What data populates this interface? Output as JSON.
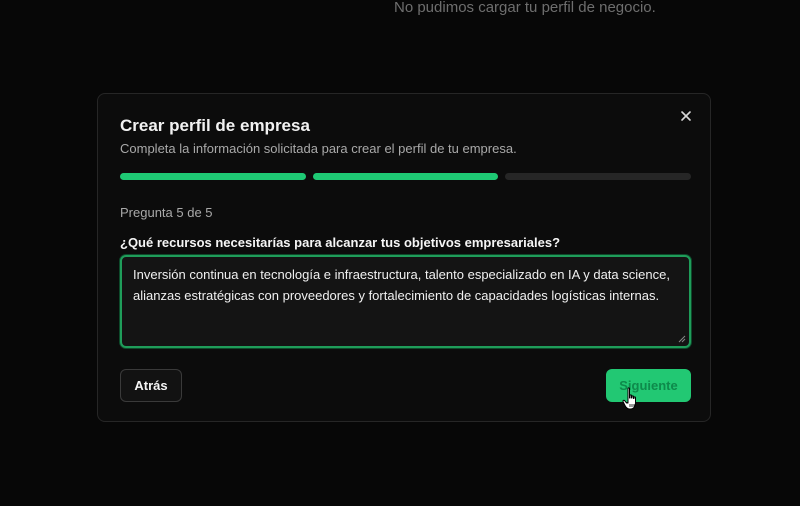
{
  "background": {
    "message": "No pudimos cargar tu perfil de negocio."
  },
  "modal": {
    "title": "Crear perfil de empresa",
    "subtitle": "Completa la información solicitada para crear el perfil de tu empresa.",
    "close_icon": "close-icon",
    "progress": {
      "segments": 3,
      "filled": 2,
      "filled_color": "#1ec974",
      "empty_color": "#262626"
    },
    "question_counter": "Pregunta 5 de 5",
    "question": "¿Qué recursos necesitarías para alcanzar tus objetivos empresariales?",
    "answer": "Inversión continua en tecnología e infraestructura, talento especializado en IA y data science, alianzas estratégicas con proveedores y fortalecimiento de capacidades logísticas internas.",
    "back_label": "Atrás",
    "next_label": "Siguiente",
    "accent_color": "#22c873"
  }
}
